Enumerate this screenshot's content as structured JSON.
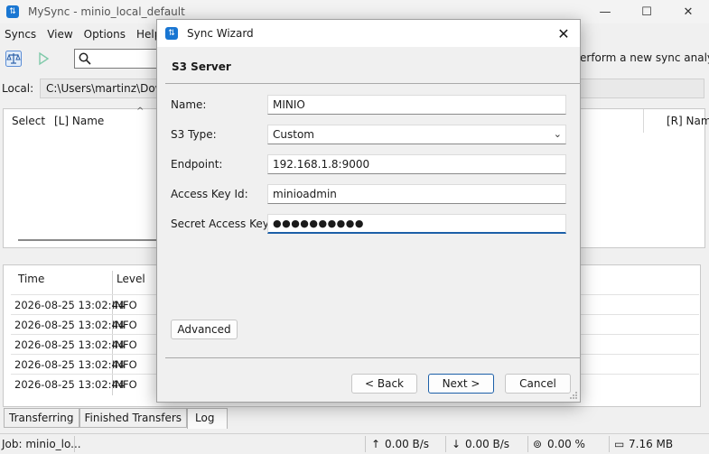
{
  "window": {
    "title": "MySync - minio_local_default",
    "minimize": "—",
    "maximize": "☐",
    "close": "✕"
  },
  "menu": [
    "Syncs",
    "View",
    "Options",
    "Help"
  ],
  "toolbar": {
    "analyze_hint": "erform a new sync analyze"
  },
  "local": {
    "label": "Local:",
    "path": "C:\\Users\\martinz\\Down"
  },
  "filelist": {
    "columns": {
      "select": "Select",
      "left_name": "[L] Name",
      "right_name": "[R] Nam"
    }
  },
  "log": {
    "columns": {
      "time": "Time",
      "level": "Level"
    },
    "rows": [
      {
        "time": "2026-08-25 13:02:44",
        "level": "INFO"
      },
      {
        "time": "2026-08-25 13:02:44",
        "level": "INFO"
      },
      {
        "time": "2026-08-25 13:02:44",
        "level": "INFO"
      },
      {
        "time": "2026-08-25 13:02:44",
        "level": "INFO"
      },
      {
        "time": "2026-08-25 13:02:44",
        "level": "INFO"
      }
    ]
  },
  "bottom_tabs": {
    "transferring": "Transferring",
    "finished": "Finished Transfers",
    "log": "Log"
  },
  "status": {
    "job": "Job: minio_lo...",
    "upload": "0.00 B/s",
    "download": "0.00 B/s",
    "cpu": "0.00 %",
    "memory": "7.16 MB"
  },
  "dialog": {
    "title": "Sync Wizard",
    "heading": "S3 Server",
    "fields": {
      "name": {
        "label": "Name:",
        "value": "MINIO"
      },
      "s3_type": {
        "label": "S3 Type:",
        "value": "Custom"
      },
      "endpoint": {
        "label": "Endpoint:",
        "value": "192.168.1.8:9000"
      },
      "access_key": {
        "label": "Access Key Id:",
        "value": "minioadmin"
      },
      "secret_key": {
        "label": "Secret Access Key:",
        "value": "●●●●●●●●●●"
      }
    },
    "advanced": "Advanced",
    "back": "< Back",
    "next": "Next >",
    "cancel": "Cancel"
  }
}
